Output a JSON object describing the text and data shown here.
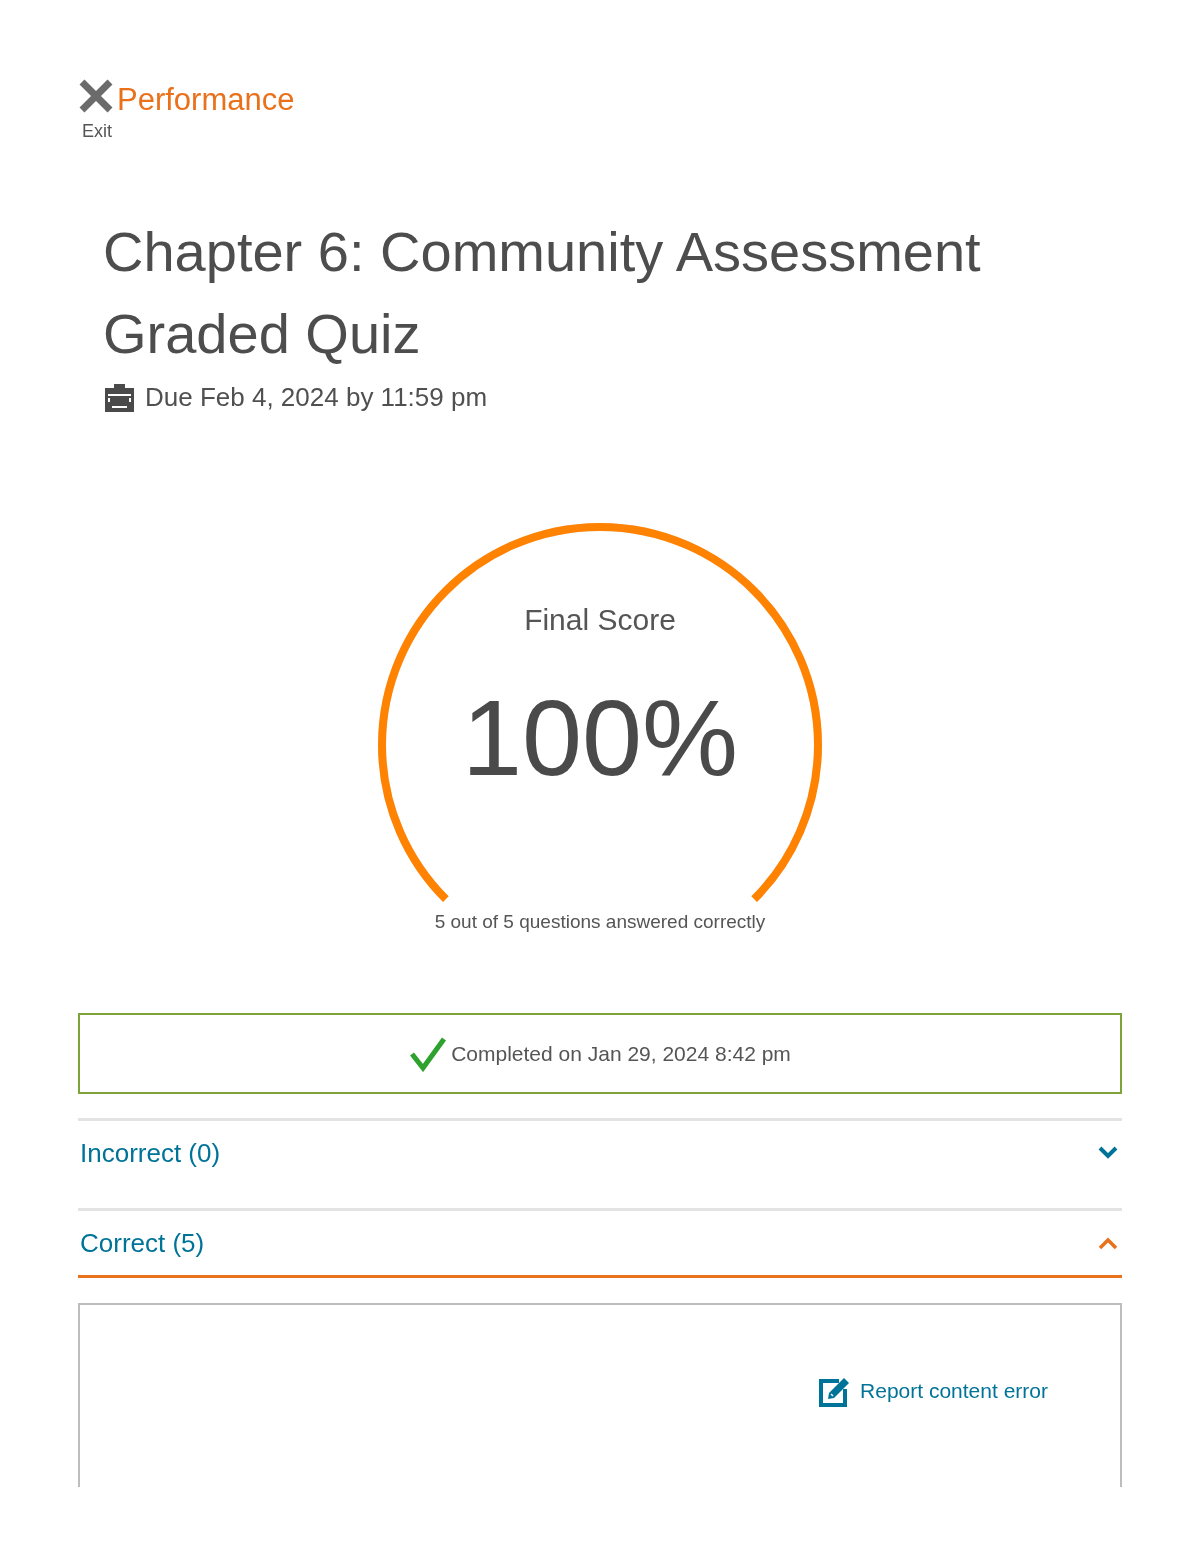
{
  "header": {
    "exit_label": "Exit",
    "title": "Performance"
  },
  "assignment": {
    "title": "Chapter 6: Community Assessment Graded Quiz",
    "due": "Due Feb 4, 2024 by 11:59 pm"
  },
  "score": {
    "label": "Final Score",
    "value": "100%",
    "level": 1,
    "summary": "5 out of 5 questions answered correctly"
  },
  "completion": {
    "text": "Completed on Jan 29, 2024 8:42 pm"
  },
  "sections": [
    {
      "label": "Incorrect (0)",
      "expanded": false
    },
    {
      "label": "Correct (5)",
      "expanded": true
    }
  ],
  "panel": {
    "link": "Report content error"
  }
}
